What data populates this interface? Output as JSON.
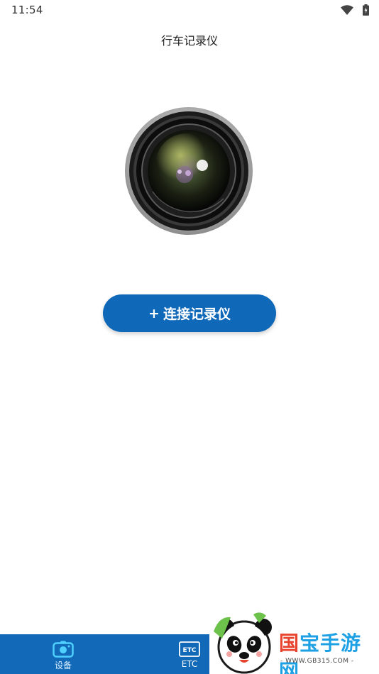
{
  "status_bar": {
    "time": "11:54",
    "icons": [
      "wifi-icon",
      "battery-icon"
    ]
  },
  "header": {
    "title": "行车记录仪"
  },
  "main": {
    "image": "camera-lens-icon",
    "connect_button": {
      "plus": "+",
      "label": "连接记录仪",
      "color": "#0f68b8"
    }
  },
  "tab_bar": {
    "color": "#1169b8",
    "tabs": [
      {
        "label": "设备",
        "icon": "camera-icon",
        "selected": true
      },
      {
        "label": "ETC",
        "icon": "etc-card-icon",
        "selected": false
      }
    ]
  },
  "watermark": {
    "brand": "国宝手游网",
    "brand_first": "国",
    "brand_rest": "宝手游网",
    "url": "- WWW.GB315.COM -"
  }
}
